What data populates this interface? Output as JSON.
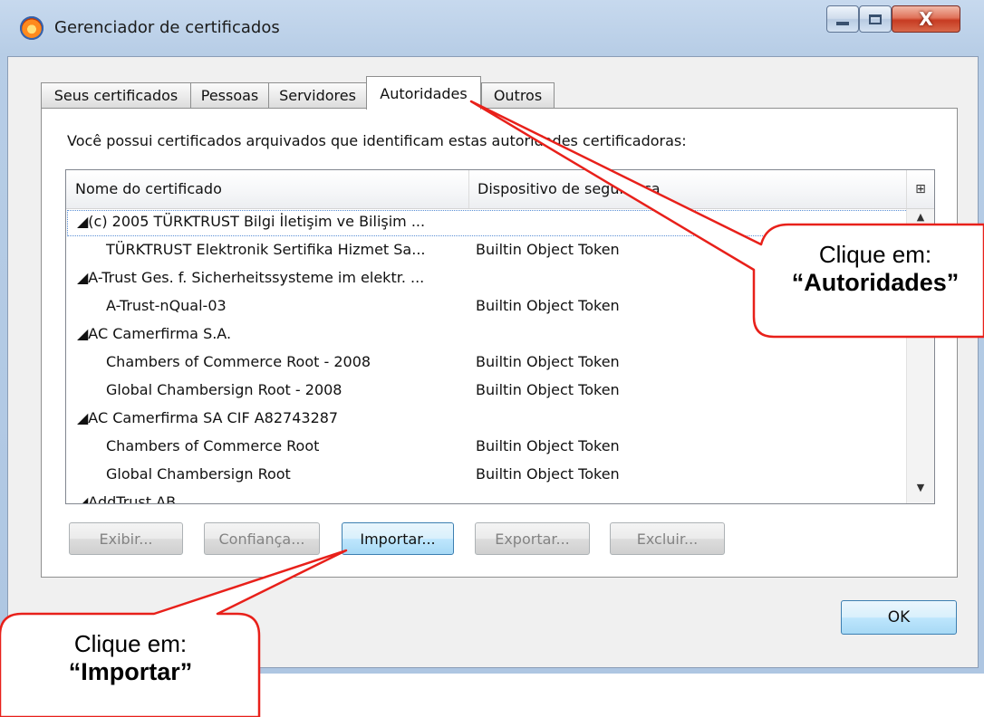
{
  "window": {
    "title": "Gerenciador de certificados",
    "close_glyph": "X"
  },
  "tabs": [
    {
      "label": "Seus certificados",
      "active": false
    },
    {
      "label": "Pessoas",
      "active": false
    },
    {
      "label": "Servidores",
      "active": false
    },
    {
      "label": "Autoridades",
      "active": true
    },
    {
      "label": "Outros",
      "active": false
    }
  ],
  "panel": {
    "intro": "Você possui certificados arquivados que identificam estas autoridades certificadoras:"
  },
  "tree": {
    "columns": {
      "name": "Nome do certificado",
      "device": "Dispositivo de segurança"
    },
    "rows": [
      {
        "type": "group",
        "name": "◢(c) 2005 TÜRKTRUST Bilgi İletişim ve Bilişim ...",
        "device": ""
      },
      {
        "type": "child",
        "name": "TÜRKTRUST Elektronik Sertifika Hizmet Sa...",
        "device": "Builtin Object Token"
      },
      {
        "type": "group",
        "name": "◢A-Trust Ges. f. Sicherheitssysteme im elektr. ...",
        "device": ""
      },
      {
        "type": "child",
        "name": "A-Trust-nQual-03",
        "device": "Builtin Object Token"
      },
      {
        "type": "group",
        "name": "◢AC Camerfirma S.A.",
        "device": ""
      },
      {
        "type": "child",
        "name": "Chambers of Commerce Root - 2008",
        "device": "Builtin Object Token"
      },
      {
        "type": "child",
        "name": "Global Chambersign Root - 2008",
        "device": "Builtin Object Token"
      },
      {
        "type": "group",
        "name": "◢AC Camerfirma SA CIF A82743287",
        "device": ""
      },
      {
        "type": "child",
        "name": "Chambers of Commerce Root",
        "device": "Builtin Object Token"
      },
      {
        "type": "child",
        "name": "Global Chambersign Root",
        "device": "Builtin Object Token"
      },
      {
        "type": "group",
        "name": "◢AddTrust AB",
        "device": ""
      }
    ]
  },
  "buttons": {
    "view": "Exibir...",
    "trust": "Confiança...",
    "import": "Importar...",
    "export": "Exportar...",
    "delete": "Excluir...",
    "ok": "OK"
  },
  "callouts": {
    "authorities_line1": "Clique em:",
    "authorities_line2": "“Autoridades”",
    "import_line1": "Clique em:",
    "import_line2": "“Importar”"
  },
  "colors": {
    "callout_border": "#e8201a",
    "window_frame": "#b7cde6",
    "focus_button": "#3c7fb1"
  }
}
